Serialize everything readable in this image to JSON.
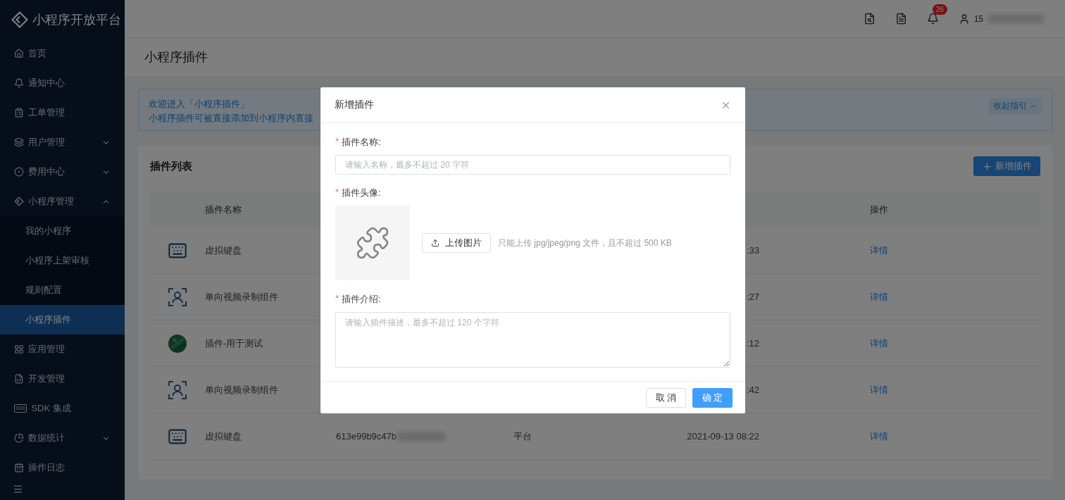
{
  "sidebar": {
    "logo": "小程序开放平台",
    "items": [
      {
        "label": "首页",
        "kind": "home",
        "selected": false
      },
      {
        "label": "通知中心",
        "kind": "bell",
        "selected": false
      },
      {
        "label": "工单管理",
        "kind": "clipboard",
        "selected": false
      },
      {
        "label": "用户管理",
        "kind": "layers",
        "selected": false,
        "expanded": false
      },
      {
        "label": "费用中心",
        "kind": "coin",
        "selected": false,
        "expanded": false
      },
      {
        "label": "小程序管理",
        "kind": "diamond",
        "selected": false,
        "expanded": true,
        "children": [
          {
            "label": "我的小程序",
            "selected": false
          },
          {
            "label": "小程序上架审核",
            "selected": false
          },
          {
            "label": "规则配置",
            "selected": false
          },
          {
            "label": "小程序插件",
            "selected": true
          }
        ]
      },
      {
        "label": "应用管理",
        "kind": "grid",
        "selected": false
      },
      {
        "label": "开发管理",
        "kind": "code",
        "selected": false
      },
      {
        "label": "SDK 集成",
        "kind": "sdk",
        "icon_text": "SDK",
        "selected": false
      },
      {
        "label": "数据统计",
        "kind": "pie",
        "selected": false,
        "expanded": false
      },
      {
        "label": "操作日志",
        "kind": "calendar",
        "selected": false
      }
    ]
  },
  "topbar": {
    "notification_count": "26",
    "user": "15"
  },
  "page_title": "小程序插件",
  "guide": {
    "lines": [
      "欢迎进入「小程序插件」",
      "小程序插件可被直接添加到小程序内直接"
    ],
    "collapse_label": "收起指引"
  },
  "plugin_list": {
    "title": "插件列表",
    "add_button": "新增插件",
    "columns": [
      "插件名称",
      "操作"
    ],
    "rows": [
      {
        "kind": "keyboard",
        "name": "虚拟键盘",
        "time": ":33",
        "action": "详情"
      },
      {
        "kind": "person",
        "name": "单向视频录制组件",
        "time": ":27",
        "action": "详情"
      },
      {
        "kind": "picture",
        "name": "插件-用于测试",
        "time": ":12",
        "action": "详情"
      },
      {
        "kind": "person",
        "name": "单向视频录制组件",
        "time": ":42",
        "action": "详情"
      },
      {
        "kind": "keyboard",
        "name": "虚拟键盘",
        "column_2": "613e99b9c47b",
        "column_3": "平台",
        "time": "2021-09-13 08:22",
        "action": "详情"
      }
    ]
  },
  "dialog": {
    "title": "新增插件",
    "name_field": {
      "mark": "*",
      "label": "插件名称:",
      "placeholder": "请输入名称，最多不超过 20 字符"
    },
    "avatar_field": {
      "mark": "*",
      "label": "插件头像:",
      "upload_button": "上传图片",
      "hint": "只能上传 jpg/jpeg/png 文件，且不超过 500 KB"
    },
    "intro_field": {
      "mark": "*",
      "label": "插件介绍:",
      "placeholder": "请输入插件描述，最多不超过 120 个字符"
    },
    "cancel": "取 消",
    "confirm": "确 定"
  }
}
